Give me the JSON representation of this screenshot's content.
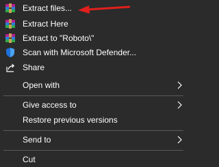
{
  "menu": {
    "items": [
      {
        "label": "Extract files...",
        "icon": "winrar-icon"
      },
      {
        "label": "Extract Here",
        "icon": "winrar-icon"
      },
      {
        "label": "Extract to \"Roboto\\\"",
        "icon": "winrar-icon"
      },
      {
        "label": "Scan with Microsoft Defender...",
        "icon": "defender-shield-icon"
      },
      {
        "label": "Share",
        "icon": "share-icon"
      },
      {
        "label": "Open with",
        "icon": "",
        "submenu": true
      },
      {
        "label": "Give access to",
        "icon": "",
        "submenu": true
      },
      {
        "label": "Restore previous versions",
        "icon": ""
      },
      {
        "label": "Send to",
        "icon": "",
        "submenu": true
      },
      {
        "label": "Cut",
        "icon": ""
      }
    ]
  },
  "annotation": {
    "type": "red-arrow",
    "color": "#e0201c",
    "points_to": "Extract files..."
  },
  "colors": {
    "background": "#2b2b2b",
    "text": "#ffffff",
    "separator": "#5a5a5a"
  }
}
